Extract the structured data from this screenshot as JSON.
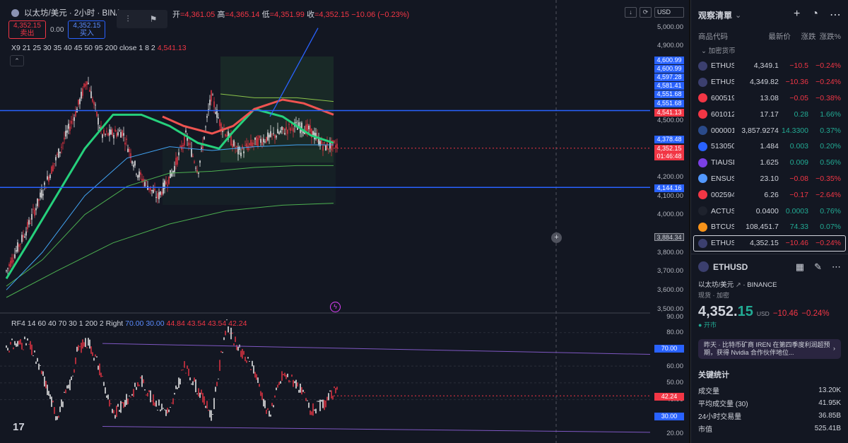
{
  "symbol_header": {
    "name": "以太坊/美元 · 2小时 · BINA",
    "open_label": "开",
    "open": "=4,361.05",
    "high_label": "高",
    "high": "=4,365.14",
    "low_label": "低",
    "low": "=4,351.99",
    "close_label": "收",
    "close": "=4,352.15",
    "change": "−10.06 (−0.23%)"
  },
  "bid_ask": {
    "sell_price": "4,352.15",
    "sell_label": "卖出",
    "spread": "0.00",
    "buy_price": "4,352.15",
    "buy_label": "买入"
  },
  "indicator_ma": {
    "text": "X9 21 25 30 35 40 45 50 95 200 close 1 8 2",
    "value": "4,541.13"
  },
  "indicator_rf": {
    "text": "RF4 14 60 40 70 30 1 200 2 Right",
    "v1": "70.00",
    "v2": "30.00",
    "v3": "44.84",
    "v4": "43.54",
    "v5": "43.54",
    "v6": "42.24"
  },
  "toolbar": {
    "currency": "USD",
    "tv_logo": "17"
  },
  "price_axis": {
    "ticks": [
      "5,000.00",
      "4,900.00",
      "4,500.00",
      "4,200.00",
      "4,100.00",
      "4,000.00",
      "3,800.00",
      "3,700.00",
      "3,600.00",
      "3,500.00"
    ],
    "tags": {
      "t1": "4,600.99",
      "t2": "4,600.99",
      "t3": "4,597.28",
      "t4": "4,581.41",
      "t5": "4,551.68",
      "t6": "4,551.68",
      "t7": "4,541.13",
      "t8": "4,378.48",
      "t9": "4,352.15",
      "t10": "01:46:48",
      "t11": "4,144.16",
      "t12": "3,884.34"
    }
  },
  "rf_axis": {
    "ticks": [
      "90.00",
      "80.00",
      "60.00",
      "50.00",
      "40.00",
      "20.00"
    ],
    "tags": {
      "a": "70.00",
      "b": "42.24",
      "c": "30.00"
    }
  },
  "chart_data": {
    "type": "line",
    "title": "以太坊/美元 · 2小时",
    "price_ylim": [
      3500,
      5000
    ],
    "horizontal_levels": [
      4551.68,
      4144.16
    ],
    "rf_ylim": [
      20,
      90
    ],
    "rf_levels": [
      70,
      30
    ],
    "last_price": 4352.15,
    "rf_last": 42.24
  },
  "watchlist": {
    "title": "观察清單",
    "columns": [
      "商品代码",
      "最新价",
      "涨跌",
      "涨跌%"
    ],
    "group": "加密货币",
    "rows": [
      {
        "sym": "ETHUSD",
        "last": "4,349.1",
        "chg": "−10.5",
        "pct": "−0.24%",
        "dir": "dn",
        "color": "#3b3f6e"
      },
      {
        "sym": "ETHUSD",
        "last": "4,349.82",
        "chg": "−10.36",
        "pct": "−0.24%",
        "dir": "dn",
        "color": "#3b3f6e"
      },
      {
        "sym": "600519",
        "last": "13.08",
        "chg": "−0.05",
        "pct": "−0.38%",
        "dir": "dn",
        "color": "#f23645"
      },
      {
        "sym": "601012",
        "last": "17.17",
        "chg": "0.28",
        "pct": "1.66%",
        "dir": "up",
        "color": "#f23645"
      },
      {
        "sym": "000001",
        "last": "3,857.9274",
        "chg": "14.3300",
        "pct": "0.37%",
        "dir": "up",
        "color": "#2a4a8a"
      },
      {
        "sym": "513050",
        "last": "1.484",
        "chg": "0.003",
        "pct": "0.20%",
        "dir": "up",
        "color": "#2962ff"
      },
      {
        "sym": "TIAUSD",
        "last": "1.625",
        "chg": "0.009",
        "pct": "0.56%",
        "dir": "up",
        "color": "#7b3fe4"
      },
      {
        "sym": "ENSUSD",
        "last": "23.10",
        "chg": "−0.08",
        "pct": "−0.35%",
        "dir": "dn",
        "color": "#5298ff"
      },
      {
        "sym": "002594",
        "last": "6.26",
        "chg": "−0.17",
        "pct": "−2.64%",
        "dir": "dn",
        "color": "#f23645"
      },
      {
        "sym": "ACTUSD",
        "last": "0.0400",
        "chg": "0.0003",
        "pct": "0.76%",
        "dir": "up",
        "color": "#1e222d"
      },
      {
        "sym": "BTCUSD",
        "last": "108,451.7",
        "chg": "74.33",
        "pct": "0.07%",
        "dir": "up",
        "color": "#f7931a"
      },
      {
        "sym": "ETHUSD",
        "last": "4,352.15",
        "chg": "−10.46",
        "pct": "−0.24%",
        "dir": "dn",
        "color": "#3b3f6e"
      }
    ]
  },
  "detail": {
    "symbol": "ETHUSD",
    "name": "以太坊/美元",
    "exchange": "BINANCE",
    "sub": "现货 · 加密",
    "price_main": "4,352.",
    "price_tail": "15",
    "currency": "USD",
    "change": "−10.46",
    "change_pct": "−0.24%",
    "status": "开市",
    "news": "昨天 · 比特币矿商 IREN 在第四季度利润超预期，获得 Nvidia 合作伙伴地位...",
    "stats_title": "关键统计",
    "stats": [
      {
        "k": "成交量",
        "v": "13.20K"
      },
      {
        "k": "平均成交量 (30)",
        "v": "41.95K"
      },
      {
        "k": "24小时交易量",
        "v": "36.85B"
      },
      {
        "k": "市值",
        "v": "525.41B"
      }
    ]
  }
}
